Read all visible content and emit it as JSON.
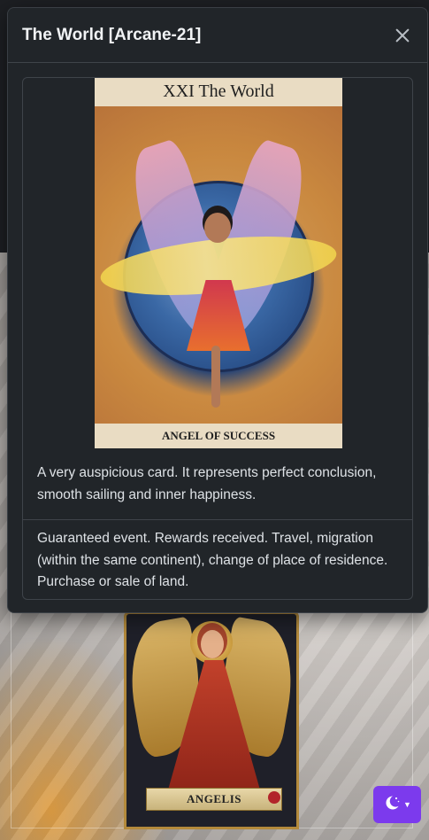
{
  "modal": {
    "title": "The World [Arcane-21]",
    "close_icon": "close-icon"
  },
  "card": {
    "image_title": "XXI The World",
    "image_caption": "ANGEL OF SUCCESS",
    "description": "A very auspicious card. It represents perfect conclusion, smooth sailing and inner happiness.",
    "meaning": "Guaranteed event. Rewards received. Travel, migration (within the same continent), change of place of residence. Purchase or sale of land."
  },
  "background": {
    "card_banner": "ANGELIS"
  },
  "theme_toggle": {
    "icon": "moon-stars-icon",
    "caret_icon": "caret-down-icon",
    "color": "#7c3aed"
  }
}
